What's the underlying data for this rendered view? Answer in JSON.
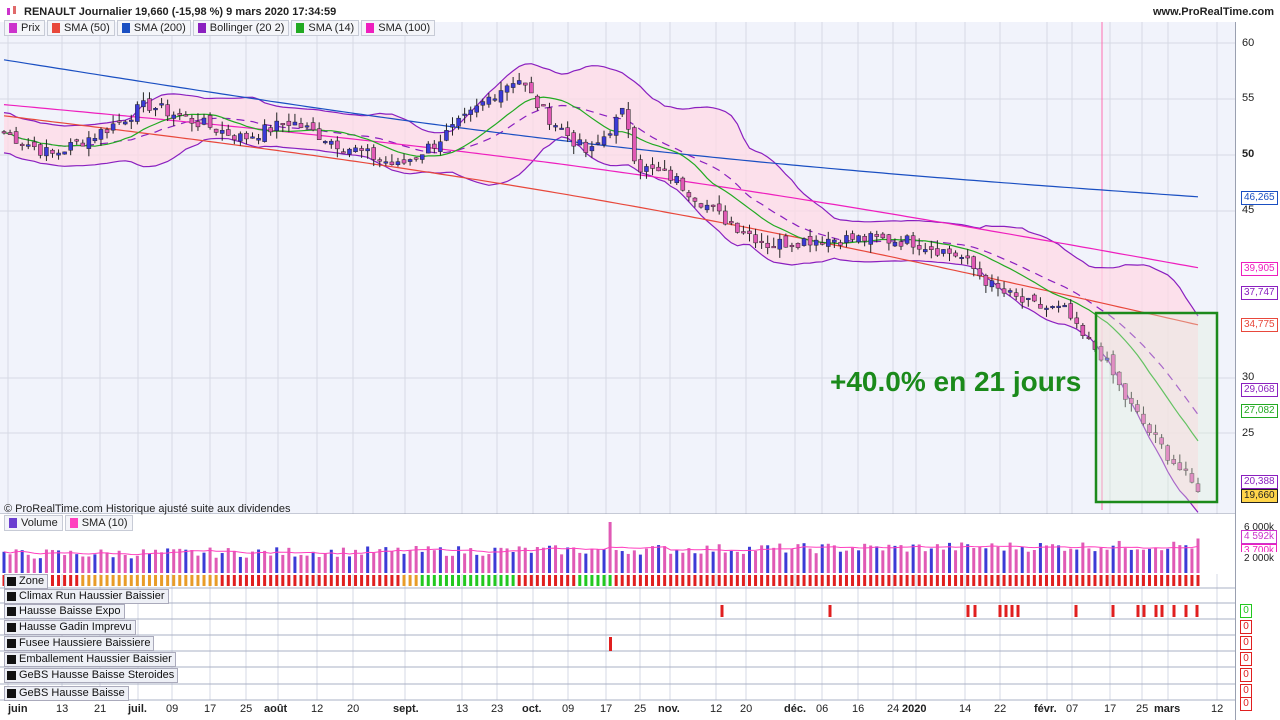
{
  "header": {
    "title": "RENAULT Journalier 19,660 (-15,98 %) 9 mars 2020 17:34:59",
    "brand": "www.ProRealTime.com"
  },
  "legend": [
    {
      "label": "Prix",
      "color": "#cc33cc"
    },
    {
      "label": "SMA (50)",
      "color": "#e8483b"
    },
    {
      "label": "SMA (200)",
      "color": "#1a4fc2"
    },
    {
      "label": "Bollinger (20 2)",
      "color": "#8a1fbf"
    },
    {
      "label": "SMA (14)",
      "color": "#22aa22"
    },
    {
      "label": "SMA (100)",
      "color": "#ee1fbe"
    }
  ],
  "copyright": "© ProRealTime.com  Historique ajusté suite aux dividendes",
  "annotation": "+40.0% en 21 jours",
  "volume_legend": [
    {
      "label": "Volume",
      "color": "#6b3fd0"
    },
    {
      "label": "SMA (10)",
      "color": "#ff3fbf"
    }
  ],
  "indicators": [
    {
      "label": "Zone"
    },
    {
      "label": "Climax Run Haussier Baissier"
    },
    {
      "label": "Hausse Baisse Expo"
    },
    {
      "label": "Hausse Gadin Imprevu"
    },
    {
      "label": "Fusee Haussiere Baissiere"
    },
    {
      "label": "Emballement Haussier Baissier"
    },
    {
      "label": "GeBS Hausse Baisse Steroides"
    },
    {
      "label": "GeBS Hausse Baisse"
    }
  ],
  "indicator_values": [
    "0",
    "0",
    "0",
    "0",
    "0",
    "0",
    "0"
  ],
  "x_labels": [
    {
      "text": "juin",
      "bold": true
    },
    {
      "text": "13",
      "bold": false
    },
    {
      "text": "21",
      "bold": false
    },
    {
      "text": "juil.",
      "bold": true
    },
    {
      "text": "09",
      "bold": false
    },
    {
      "text": "17",
      "bold": false
    },
    {
      "text": "25",
      "bold": false
    },
    {
      "text": "août",
      "bold": true
    },
    {
      "text": "12",
      "bold": false
    },
    {
      "text": "20",
      "bold": false
    },
    {
      "text": "sept.",
      "bold": true
    },
    {
      "text": "13",
      "bold": false
    },
    {
      "text": "23",
      "bold": false
    },
    {
      "text": "oct.",
      "bold": true
    },
    {
      "text": "09",
      "bold": false
    },
    {
      "text": "17",
      "bold": false
    },
    {
      "text": "25",
      "bold": false
    },
    {
      "text": "nov.",
      "bold": true
    },
    {
      "text": "12",
      "bold": false
    },
    {
      "text": "20",
      "bold": false
    },
    {
      "text": "déc.",
      "bold": true
    },
    {
      "text": "06",
      "bold": false
    },
    {
      "text": "16",
      "bold": false
    },
    {
      "text": "24",
      "bold": false
    },
    {
      "text": "2020",
      "bold": true
    },
    {
      "text": "14",
      "bold": false
    },
    {
      "text": "22",
      "bold": false
    },
    {
      "text": "févr.",
      "bold": true
    },
    {
      "text": "07",
      "bold": false
    },
    {
      "text": "17",
      "bold": false
    },
    {
      "text": "25",
      "bold": false
    },
    {
      "text": "mars",
      "bold": true
    },
    {
      "text": "12",
      "bold": false
    }
  ],
  "price_axis": [
    {
      "text": "60",
      "bold": false
    },
    {
      "text": "55",
      "bold": false
    },
    {
      "text": "50",
      "bold": true
    },
    {
      "text": "45",
      "bold": false
    },
    {
      "text": "30",
      "bold": false
    },
    {
      "text": "25",
      "bold": false
    }
  ],
  "price_tags": [
    {
      "text": "46,265",
      "color": "#1a4fc2"
    },
    {
      "text": "39,905",
      "color": "#ee1fbe"
    },
    {
      "text": "37,747",
      "color": "#8a1fbf"
    },
    {
      "text": "34,775",
      "color": "#e8483b"
    },
    {
      "text": "29,068",
      "color": "#8a1fbf"
    },
    {
      "text": "27,082",
      "color": "#22aa22"
    },
    {
      "text": "20,388",
      "color": "#8a1fbf"
    },
    {
      "text": "19,660",
      "color": "#222222"
    }
  ],
  "volume_axis": [
    {
      "text": "6 000k"
    },
    {
      "text": "4 592k"
    },
    {
      "text": "3 700k"
    },
    {
      "text": "2 000k"
    }
  ],
  "chart_data": {
    "type": "candlestick",
    "title": "RENAULT Journalier",
    "y_ticks": [
      60,
      55,
      50,
      45,
      30,
      25
    ],
    "close_path": [
      [
        0,
        52
      ],
      [
        0.04,
        50
      ],
      [
        0.08,
        52
      ],
      [
        0.12,
        54.5
      ],
      [
        0.16,
        53
      ],
      [
        0.2,
        51.5
      ],
      [
        0.24,
        53
      ],
      [
        0.28,
        51
      ],
      [
        0.33,
        49
      ],
      [
        0.36,
        51
      ],
      [
        0.39,
        53.5
      ],
      [
        0.41,
        55.5
      ],
      [
        0.43,
        57
      ],
      [
        0.45,
        54
      ],
      [
        0.47,
        52
      ],
      [
        0.49,
        50
      ],
      [
        0.52,
        54
      ],
      [
        0.53,
        49
      ],
      [
        0.56,
        48
      ],
      [
        0.6,
        44.5
      ],
      [
        0.64,
        42
      ],
      [
        0.68,
        42.5
      ],
      [
        0.72,
        42.5
      ],
      [
        0.76,
        42.3
      ],
      [
        0.8,
        41
      ],
      [
        0.83,
        38
      ],
      [
        0.86,
        36.5
      ],
      [
        0.89,
        36
      ],
      [
        0.9,
        34
      ],
      [
        0.92,
        32
      ],
      [
        0.94,
        28
      ],
      [
        0.96,
        25
      ],
      [
        1,
        19.66
      ]
    ],
    "sma50_last": 34.775,
    "sma200_last": 46.265,
    "sma100_last": 39.905,
    "sma14_last": 27.082,
    "bollinger_upper_last": 37.747,
    "bollinger_mid_last": 29.068,
    "bollinger_lower_last": 20.388,
    "last_close": 19.66
  }
}
